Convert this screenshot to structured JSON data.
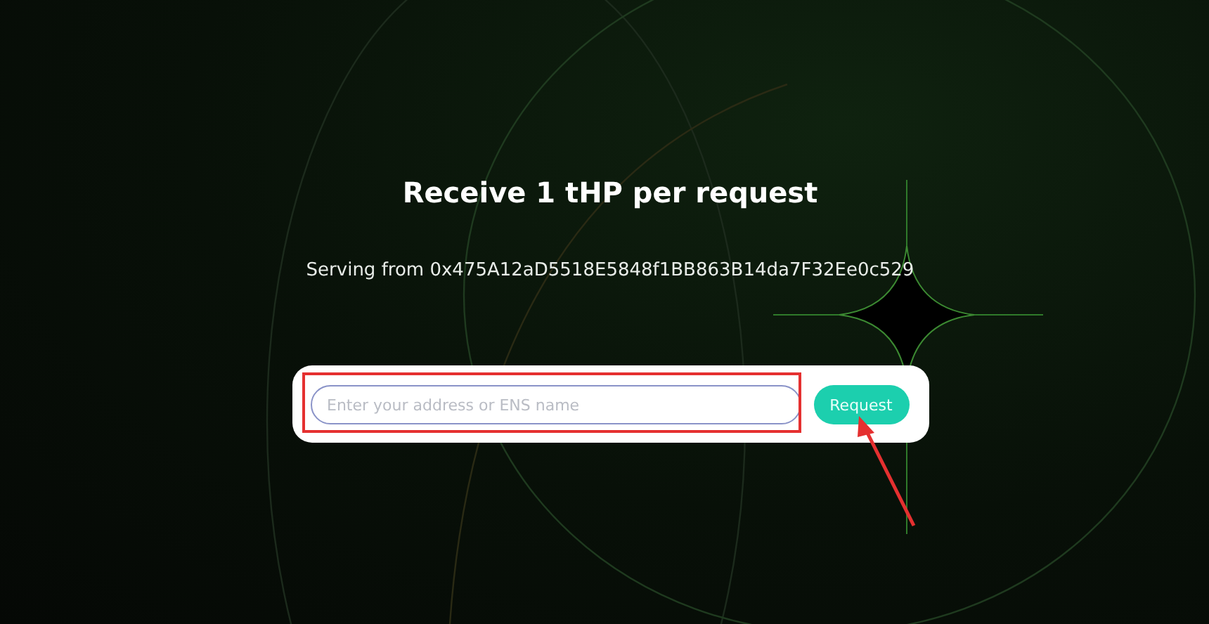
{
  "title": "Receive 1 tHP per request",
  "serving": "Serving from 0x475A12aD5518E5848f1BB863B14da7F32Ee0c529",
  "form": {
    "placeholder": "Enter your address or ENS name",
    "button": "Request"
  },
  "annotation": {
    "highlight": true,
    "arrow": true
  }
}
